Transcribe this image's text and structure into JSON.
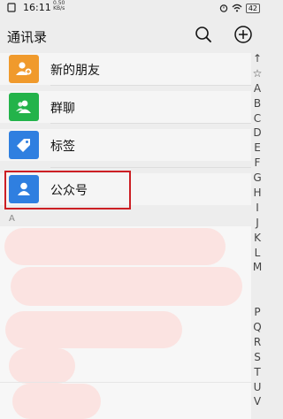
{
  "status_bar": {
    "time": "16:11",
    "net_speed": "0.50",
    "net_unit": "KB/s",
    "battery": "42"
  },
  "header": {
    "title": "通讯录",
    "icons": [
      "search-icon",
      "add-circle-icon"
    ]
  },
  "menu": [
    {
      "label": "新的朋友",
      "icon": "add-friend-icon",
      "color": "#f09a2c"
    },
    {
      "label": "群聊",
      "icon": "group-chat-icon",
      "color": "#23b34a"
    },
    {
      "label": "标签",
      "icon": "tag-icon",
      "color": "#2f7fe0"
    },
    {
      "label": "公众号",
      "icon": "official-account-icon",
      "color": "#2f7fe0"
    }
  ],
  "section": "A",
  "index_letters": [
    "↑",
    "☆",
    "A",
    "B",
    "C",
    "D",
    "E",
    "F",
    "G",
    "H",
    "I",
    "J",
    "K",
    "L",
    "M",
    "",
    "",
    "P",
    "Q",
    "R",
    "S",
    "T",
    "U",
    "V"
  ],
  "highlight_color": "#cc1f24"
}
